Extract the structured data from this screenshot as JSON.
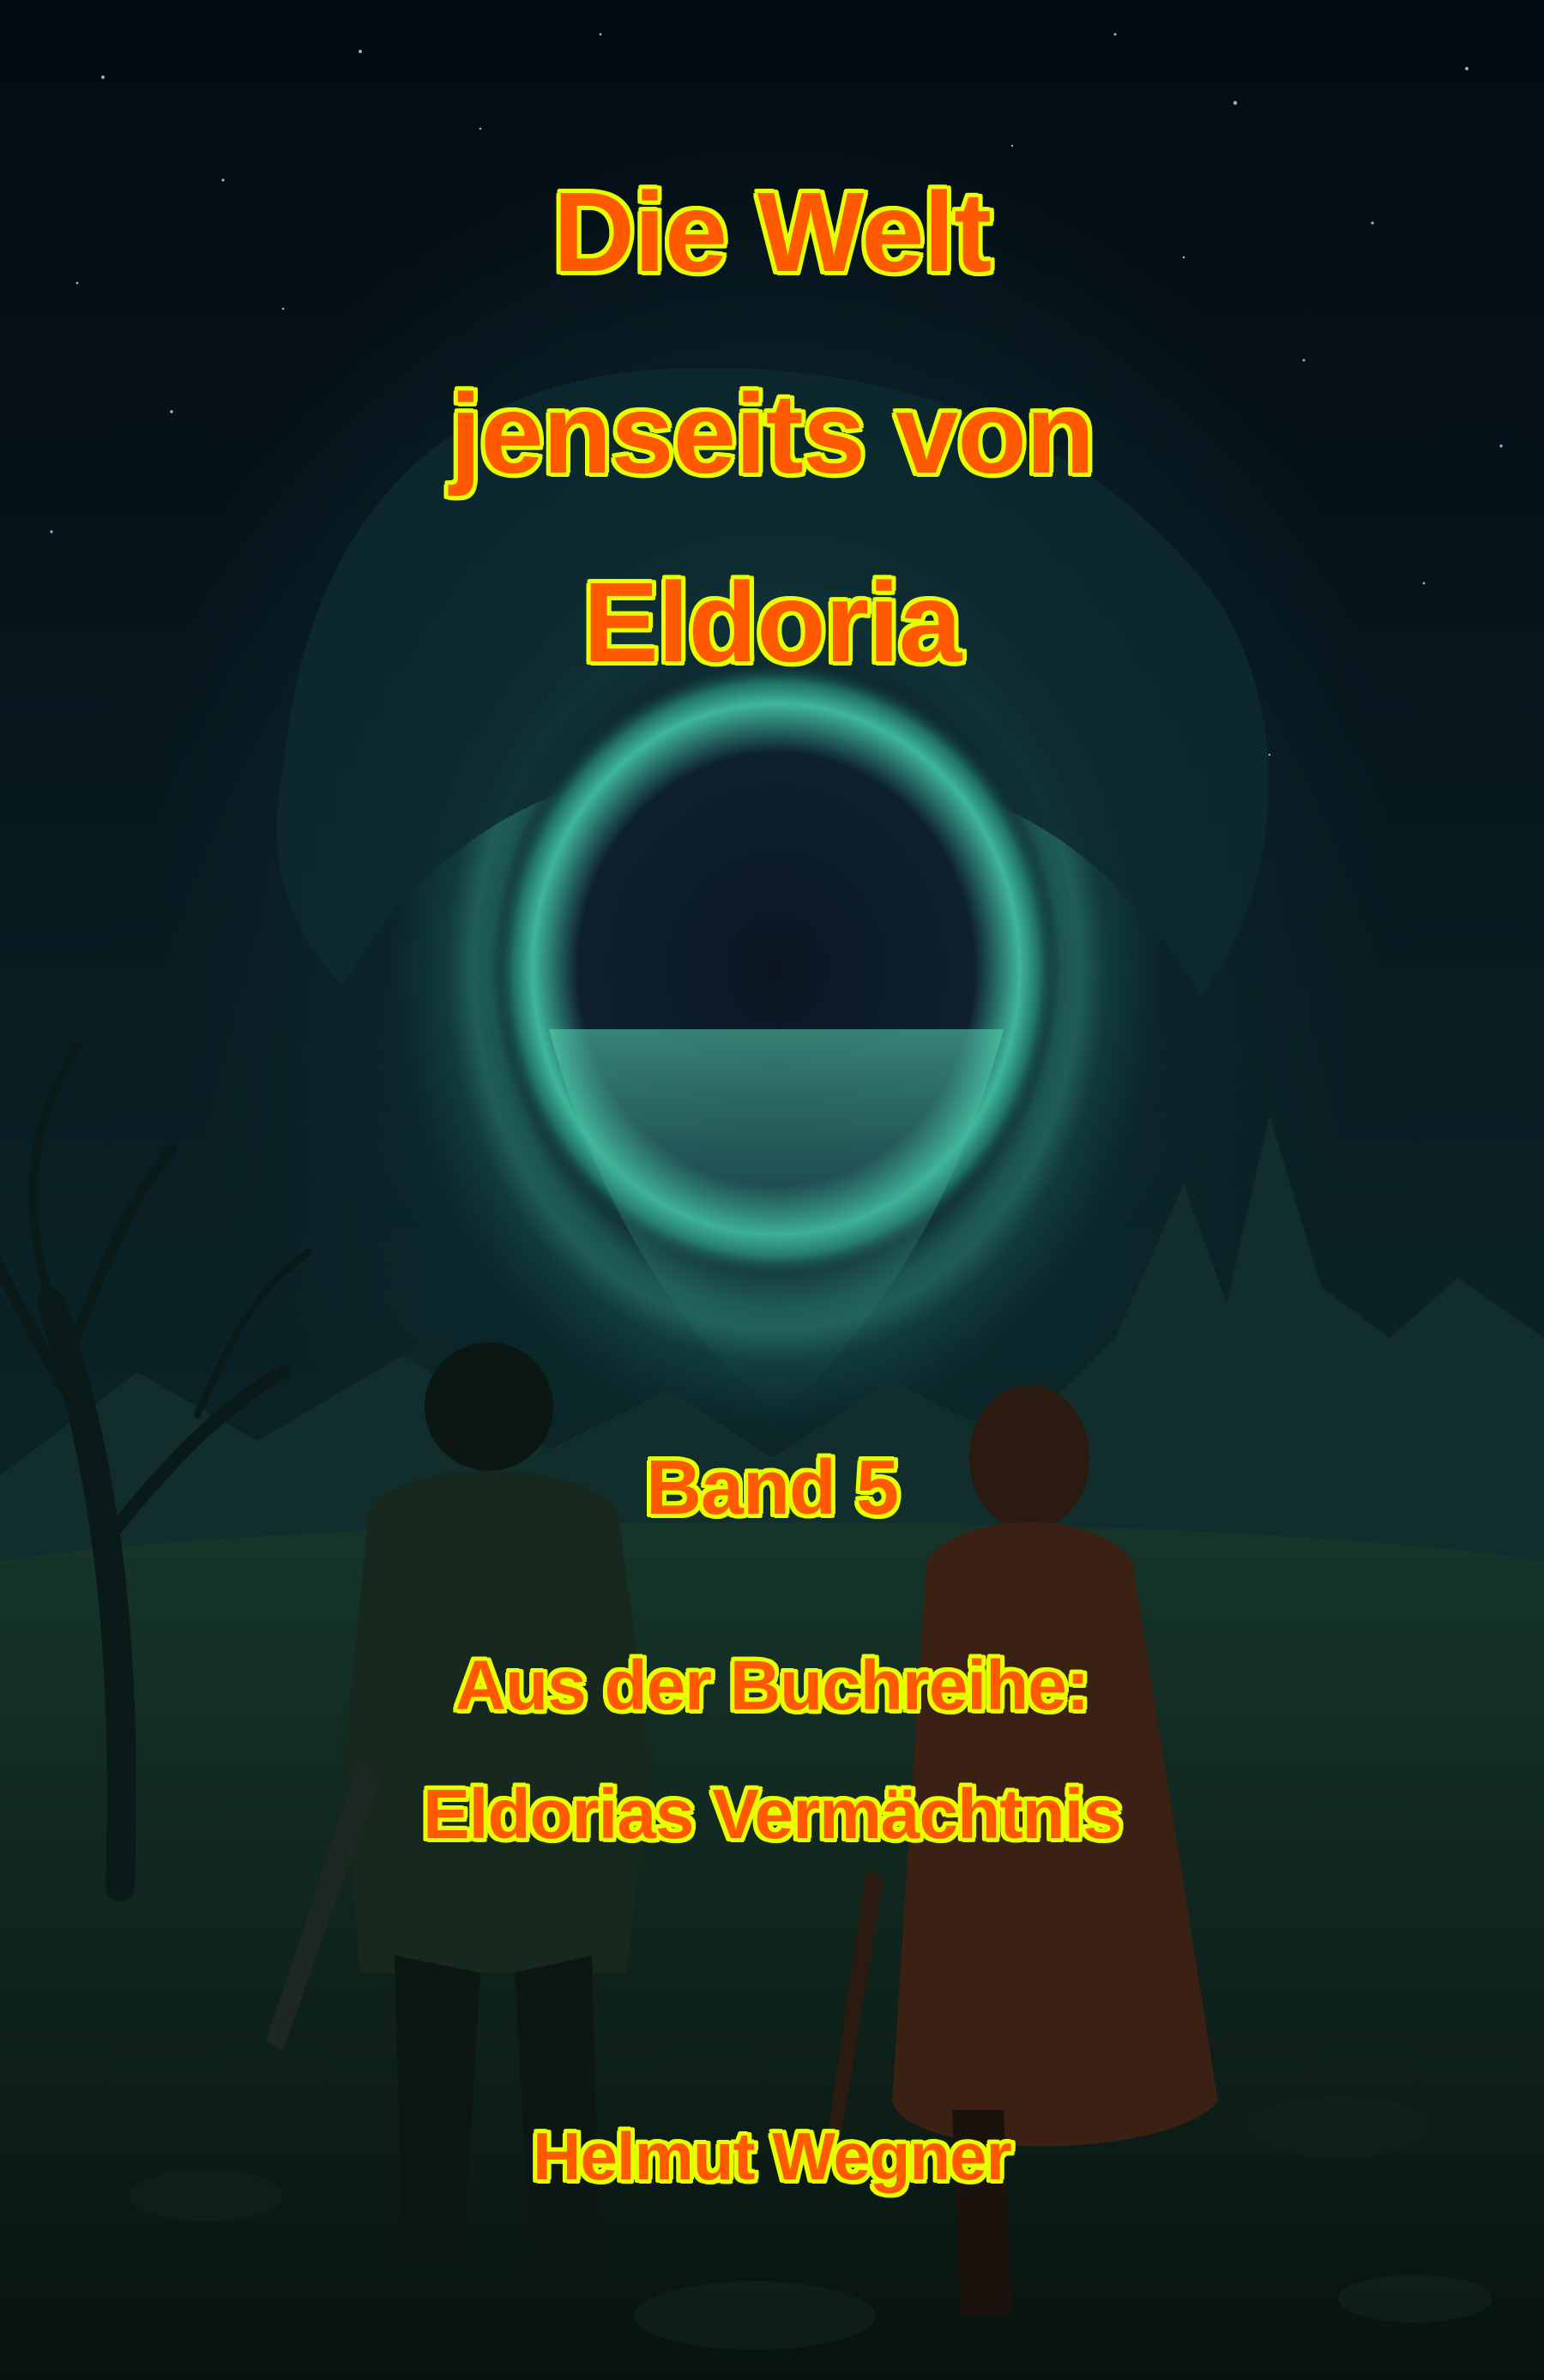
{
  "cover": {
    "title_lines": [
      "Die Welt",
      "jenseits von",
      "Eldoria"
    ],
    "band": "Band 5",
    "series_label": "Aus der Buchreihe:",
    "series_name": "Eldorias Vermächtnis",
    "author": "Helmut Wegner",
    "colors": {
      "text_fill": "#ff5a00",
      "text_outline": "#e8ff00",
      "portal_glow": "#46bea0",
      "night_sky": "#040a12"
    },
    "artwork": {
      "scene": "night-sky-portal-mountains",
      "figures": [
        "figure-man-with-sword",
        "figure-woman-in-cloak"
      ],
      "icons": [
        "portal-icon",
        "dead-tree-icon",
        "stars-icon"
      ]
    }
  }
}
